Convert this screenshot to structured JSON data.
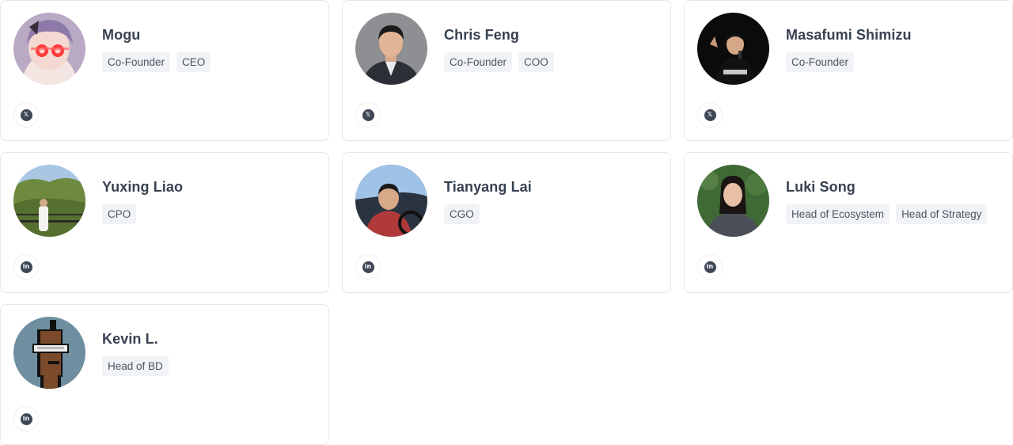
{
  "team": [
    {
      "name": "Mogu",
      "tags": [
        "Co-Founder",
        "CEO"
      ],
      "social": "x",
      "social_glyph": "𝕏",
      "avatar_icon": "anime-character-avatar"
    },
    {
      "name": "Chris Feng",
      "tags": [
        "Co-Founder",
        "COO"
      ],
      "social": "x",
      "social_glyph": "𝕏",
      "avatar_icon": "portrait-photo-avatar"
    },
    {
      "name": "Masafumi Shimizu",
      "tags": [
        "Co-Founder"
      ],
      "social": "x",
      "social_glyph": "𝕏",
      "avatar_icon": "speaker-photo-avatar"
    },
    {
      "name": "Yuxing Liao",
      "tags": [
        "CPO"
      ],
      "social": "linkedin",
      "social_glyph": "in",
      "avatar_icon": "landscape-photo-avatar"
    },
    {
      "name": "Tianyang Lai",
      "tags": [
        "CGO"
      ],
      "social": "linkedin",
      "social_glyph": "in",
      "avatar_icon": "car-selfie-avatar"
    },
    {
      "name": "Luki Song",
      "tags": [
        "Head of Ecosystem",
        "Head of Strategy"
      ],
      "social": "linkedin",
      "social_glyph": "in",
      "avatar_icon": "portrait-photo-avatar"
    },
    {
      "name": "Kevin L.",
      "tags": [
        "Head of BD"
      ],
      "social": "linkedin",
      "social_glyph": "in",
      "avatar_icon": "pixel-punk-avatar"
    }
  ],
  "colors": {
    "card_border": "#e5e7eb",
    "tag_bg": "#f1f3f7",
    "text": "#374151",
    "icon": "#3f4655"
  }
}
